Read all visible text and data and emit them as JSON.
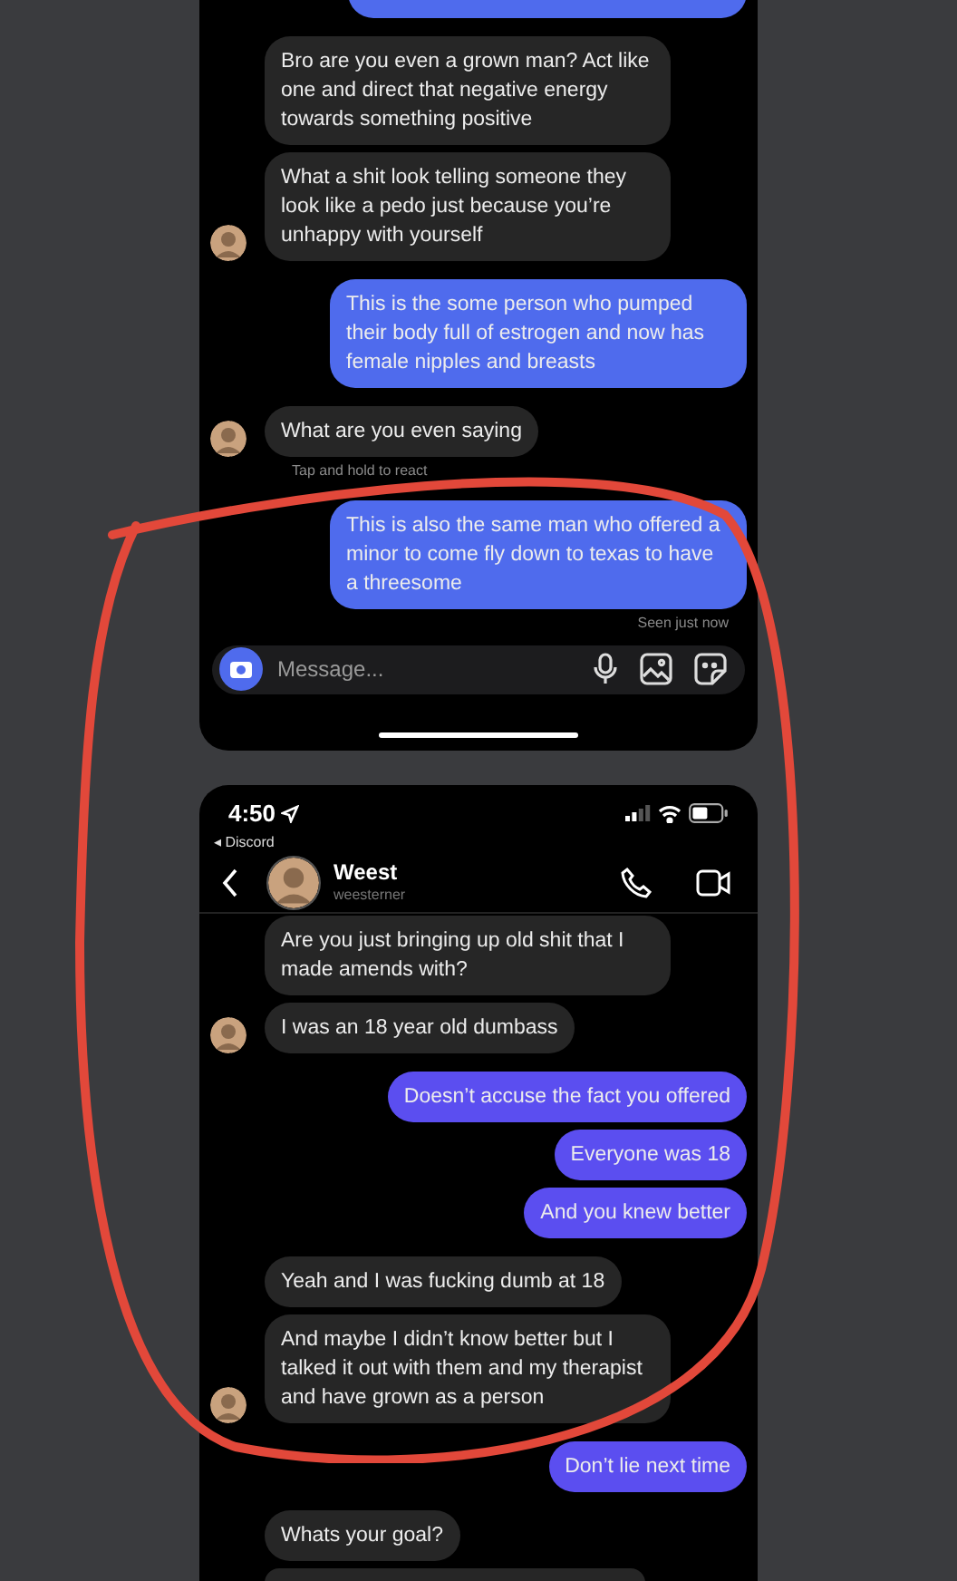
{
  "panels": [
    {
      "kind": "chat",
      "color": "#4f6bed",
      "groups": [
        {
          "kind": "sent",
          "clipped": true
        },
        {
          "kind": "received",
          "avatar": true,
          "messages": [
            "Bro are you even a grown man? Act like one and direct that negative energy towards something positive",
            "What a shit look telling someone they look like a pedo just because you’re unhappy with yourself"
          ]
        },
        {
          "kind": "sent",
          "messages": [
            "This is the some person who pumped their body full of estrogen and now has female nipples and breasts"
          ]
        },
        {
          "kind": "received",
          "avatar": true,
          "messages": [
            "What are you even saying"
          ],
          "note": "Tap and hold to react"
        },
        {
          "kind": "sent",
          "messages": [
            "This is also the same man who offered a minor to come fly down to texas to have a threesome"
          ],
          "note": "Seen just now"
        }
      ],
      "composer": {
        "placeholder": "Message..."
      }
    },
    {
      "kind": "thread",
      "color": "#5b4ef0",
      "status": {
        "time": "4:50",
        "back_app": "◂ Discord"
      },
      "header": {
        "name": "Weest",
        "username": "weesterner"
      },
      "groups": [
        {
          "kind": "received",
          "avatar": true,
          "messages": [
            "Are you just bringing up old shit that I made amends with?",
            "I was an 18 year old dumbass"
          ]
        },
        {
          "kind": "sent",
          "messages": [
            "Doesn’t accuse the fact you offered",
            "Everyone was 18",
            "And you knew better"
          ]
        },
        {
          "kind": "received",
          "avatar": true,
          "messages": [
            "Yeah and I was fucking dumb at 18",
            "And maybe I didn’t know better but I talked it out with them and my therapist and have grown as a person"
          ]
        },
        {
          "kind": "sent",
          "messages": [
            "Don’t lie next time"
          ]
        },
        {
          "kind": "received",
          "avatar": false,
          "clipped": true,
          "messages": [
            "Whats your goal?"
          ]
        }
      ]
    }
  ]
}
